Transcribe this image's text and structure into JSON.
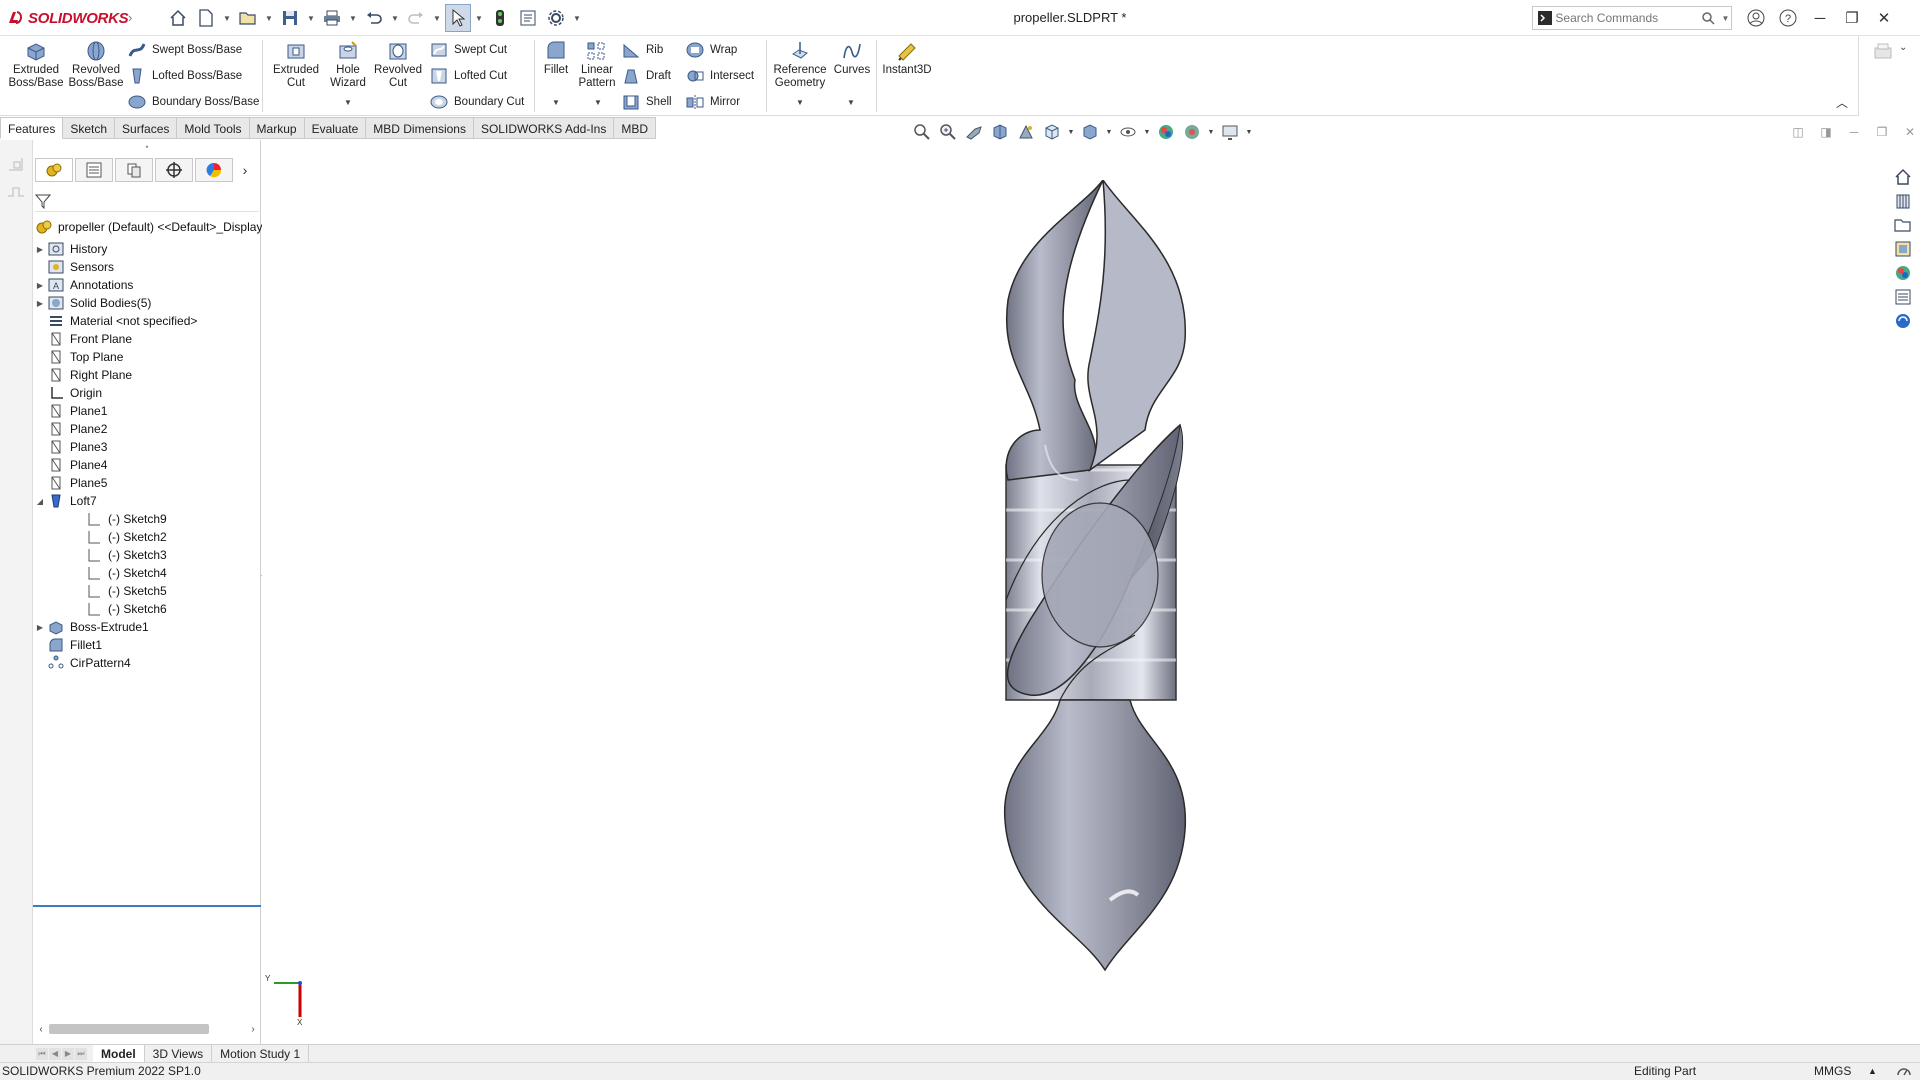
{
  "app": {
    "brand": "SOLIDWORKS",
    "doc_title": "propeller.SLDPRT *"
  },
  "search": {
    "placeholder": "Search Commands"
  },
  "command_manager": {
    "extruded_boss": "Extruded\nBoss/Base",
    "revolved_boss": "Revolved\nBoss/Base",
    "swept_boss": "Swept Boss/Base",
    "lofted_boss": "Lofted Boss/Base",
    "boundary_boss": "Boundary Boss/Base",
    "extruded_cut": "Extruded\nCut",
    "hole_wizard": "Hole\nWizard",
    "revolved_cut": "Revolved\nCut",
    "swept_cut": "Swept Cut",
    "lofted_cut": "Lofted Cut",
    "boundary_cut": "Boundary Cut",
    "fillet": "Fillet",
    "linear_pattern": "Linear\nPattern",
    "rib": "Rib",
    "draft": "Draft",
    "shell": "Shell",
    "wrap": "Wrap",
    "intersect": "Intersect",
    "mirror": "Mirror",
    "reference_geometry": "Reference\nGeometry",
    "curves": "Curves",
    "instant3d": "Instant3D"
  },
  "tabs": [
    "Features",
    "Sketch",
    "Surfaces",
    "Mold Tools",
    "Markup",
    "Evaluate",
    "MBD Dimensions",
    "SOLIDWORKS Add-Ins",
    "MBD"
  ],
  "feature_tree": {
    "root": "propeller (Default) <<Default>_Display",
    "items": [
      {
        "label": "History",
        "expandable": true
      },
      {
        "label": "Sensors",
        "expandable": false
      },
      {
        "label": "Annotations",
        "expandable": true
      },
      {
        "label": "Solid Bodies(5)",
        "expandable": true
      },
      {
        "label": "Material <not specified>",
        "expandable": false
      },
      {
        "label": "Front Plane",
        "expandable": false
      },
      {
        "label": "Top Plane",
        "expandable": false
      },
      {
        "label": "Right Plane",
        "expandable": false
      },
      {
        "label": "Origin",
        "expandable": false
      },
      {
        "label": "Plane1",
        "expandable": false
      },
      {
        "label": "Plane2",
        "expandable": false
      },
      {
        "label": "Plane3",
        "expandable": false
      },
      {
        "label": "Plane4",
        "expandable": false
      },
      {
        "label": "Plane5",
        "expandable": false
      },
      {
        "label": "Loft7",
        "expandable": true,
        "expanded": true
      },
      {
        "label": "(-) Sketch9",
        "child": true
      },
      {
        "label": "(-) Sketch2",
        "child": true
      },
      {
        "label": "(-) Sketch3",
        "child": true
      },
      {
        "label": "(-) Sketch4",
        "child": true
      },
      {
        "label": "(-) Sketch5",
        "child": true
      },
      {
        "label": "(-) Sketch6",
        "child": true
      },
      {
        "label": "Boss-Extrude1",
        "expandable": true
      },
      {
        "label": "Fillet1",
        "expandable": false
      },
      {
        "label": "CirPattern4",
        "expandable": false
      }
    ]
  },
  "bottom_tabs": [
    "Model",
    "3D Views",
    "Motion Study 1"
  ],
  "status": {
    "left": "SOLIDWORKS Premium 2022 SP1.0",
    "editing": "Editing Part",
    "units": "MMGS"
  },
  "triad": {
    "x": "X",
    "y": "Y"
  },
  "colors": {
    "brand": "#c8102e",
    "selection_line": "#3a7dc4",
    "model": "#9a9cab"
  }
}
